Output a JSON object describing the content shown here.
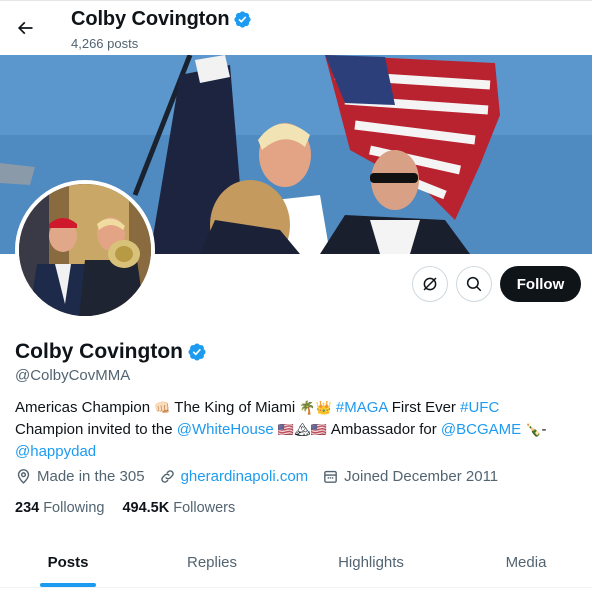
{
  "header": {
    "name": "Colby Covington",
    "posts_count": "4,266 posts"
  },
  "profile": {
    "name": "Colby Covington",
    "handle": "@ColbyCovMMA",
    "verified_color": "#1d9bf0",
    "follow_label": "Follow",
    "bio": {
      "t1": "Americas Champion ",
      "e1": "👊🏻",
      "t2": " The King of Miami ",
      "e2": "🌴👑",
      "t3": " ",
      "tag1": "#MAGA",
      "t4": " First Ever ",
      "tag2": "#UFC",
      "t5": "Champion invited to the ",
      "mention1": "@WhiteHouse",
      "e3": " 🇺🇸🏔🇺🇸 ",
      "t6": " Ambassador for ",
      "mention2": "@BCGAME",
      "e4": " 🍾",
      "t7": "-",
      "mention3": "@happydad"
    },
    "location": "Made in the 305",
    "website": "gherardinapoli.com",
    "joined": "Joined December 2011",
    "following_count": "234",
    "following_label": "Following",
    "followers_count": "494.5K",
    "followers_label": "Followers"
  },
  "tabs": [
    {
      "label": "Posts",
      "active": true
    },
    {
      "label": "Replies",
      "active": false
    },
    {
      "label": "Highlights",
      "active": false
    },
    {
      "label": "Media",
      "active": false
    }
  ],
  "icons": {
    "back": "arrow-left-icon",
    "verified": "verified-badge-icon",
    "grok": "grok-icon",
    "search": "search-icon",
    "location": "location-pin-icon",
    "link": "link-icon",
    "calendar": "calendar-icon"
  },
  "colors": {
    "accent": "#1d9bf0",
    "text": "#0f1419",
    "secondary": "#536471",
    "follow_bg": "#0f1419"
  }
}
